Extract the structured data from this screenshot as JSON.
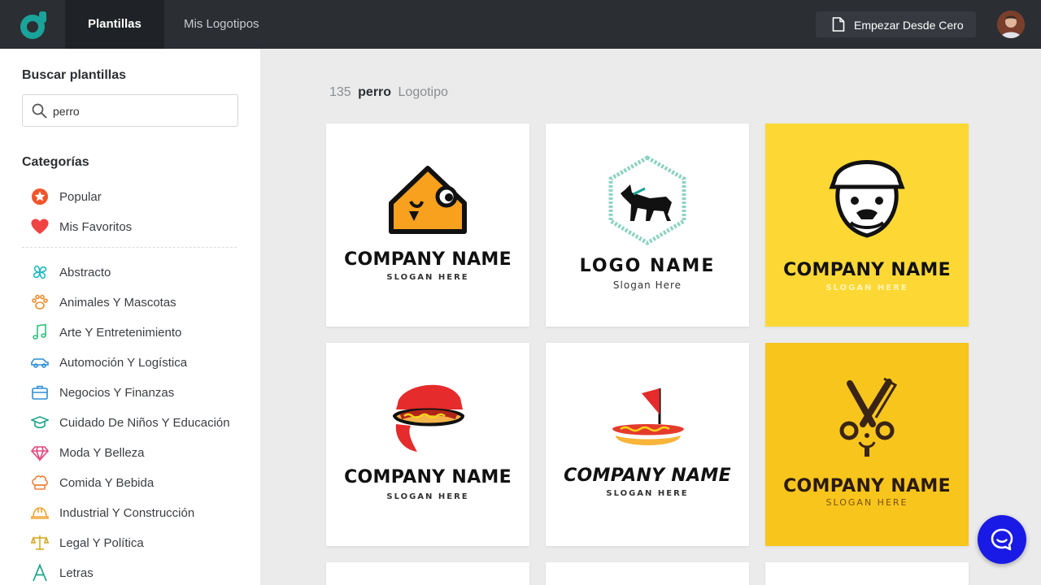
{
  "header": {
    "tabs": [
      {
        "label": "Plantillas",
        "active": true
      },
      {
        "label": "Mis Logotipos",
        "active": false
      }
    ],
    "start_button": "Empezar Desde Cero",
    "logo_icon": "brand-logo-icon",
    "accent": "#1aa39a"
  },
  "sidebar": {
    "search_heading": "Buscar plantillas",
    "search_value": "perro",
    "categories_heading": "Categorías",
    "top_items": [
      {
        "label": "Popular",
        "icon": "star-icon",
        "color": "#f0562b"
      },
      {
        "label": "Mis Favoritos",
        "icon": "heart-icon",
        "color": "#f04343"
      }
    ],
    "items": [
      {
        "label": "Abstracto",
        "icon": "abstract-icon",
        "color": "#1fb8c4"
      },
      {
        "label": "Animales Y Mascotas",
        "icon": "paw-icon",
        "color": "#f08a2b"
      },
      {
        "label": "Arte Y Entretenimiento",
        "icon": "music-note-icon",
        "color": "#2bbf7a"
      },
      {
        "label": "Automoción Y Logística",
        "icon": "car-icon",
        "color": "#2b8fd6"
      },
      {
        "label": "Negocios Y Finanzas",
        "icon": "briefcase-icon",
        "color": "#2b8fd6"
      },
      {
        "label": "Cuidado De Niños Y Educación",
        "icon": "graduation-cap-icon",
        "color": "#1fa58a"
      },
      {
        "label": "Moda Y Belleza",
        "icon": "diamond-icon",
        "color": "#e0467c"
      },
      {
        "label": "Comida Y Bebida",
        "icon": "chef-hat-icon",
        "color": "#f0803a"
      },
      {
        "label": "Industrial Y Construcción",
        "icon": "helmet-icon",
        "color": "#f0a22b"
      },
      {
        "label": "Legal Y Política",
        "icon": "scales-icon",
        "color": "#d4a51c"
      },
      {
        "label": "Letras",
        "icon": "letter-a-icon",
        "color": "#1fa58a"
      }
    ]
  },
  "main": {
    "result_count": "135",
    "result_term": "perro",
    "result_suffix": "Logotipo",
    "cards": [
      {
        "name": "COMPANY NAME",
        "slogan": "SLOGAN HERE",
        "icon": "dog-house-icon"
      },
      {
        "name": "LOGO NAME",
        "slogan": "Slogan Here",
        "icon": "dog-hexagon-icon"
      },
      {
        "name": "COMPANY NAME",
        "slogan": "SLOGAN HERE",
        "icon": "bulldog-cap-icon"
      },
      {
        "name": "COMPANY NAME",
        "slogan": "SLOGAN HERE",
        "icon": "hot-dog-cap-icon"
      },
      {
        "name": "COMPANY NAME",
        "slogan": "SLOGAN HERE",
        "icon": "hot-dog-boat-icon"
      },
      {
        "name": "COMPANY NAME",
        "slogan": "SLOGAN HERE",
        "icon": "scissors-comb-dog-icon"
      }
    ]
  }
}
